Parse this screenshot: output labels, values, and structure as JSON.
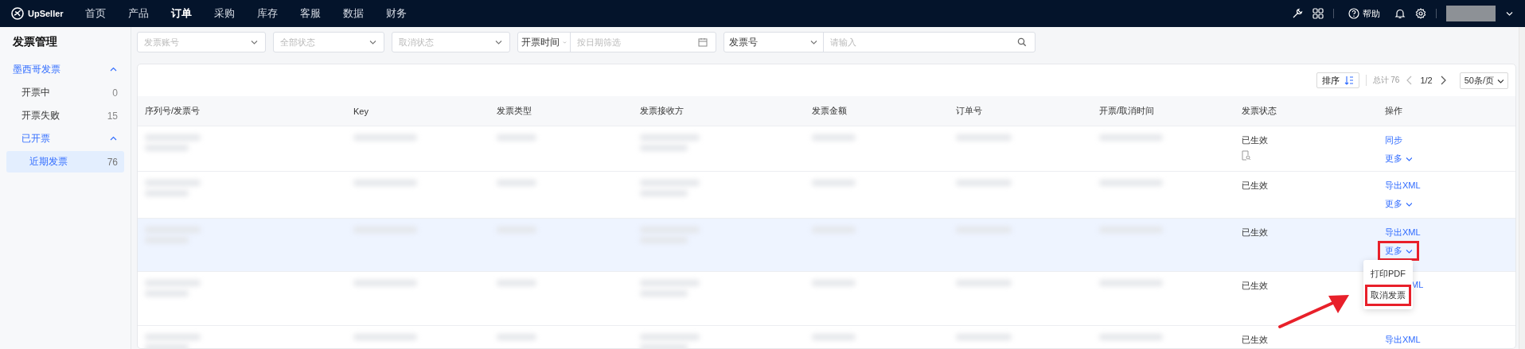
{
  "topbar": {
    "logo": "UpSeller",
    "nav": [
      {
        "label": "首页",
        "selected": false
      },
      {
        "label": "产品",
        "selected": false
      },
      {
        "label": "订单",
        "selected": true
      },
      {
        "label": "采购",
        "selected": false
      },
      {
        "label": "库存",
        "selected": false
      },
      {
        "label": "客服",
        "selected": false
      },
      {
        "label": "数据",
        "selected": false
      },
      {
        "label": "财务",
        "selected": false
      }
    ],
    "help": "帮助"
  },
  "sidebar": {
    "title": "发票管理",
    "items": [
      {
        "label": "墨西哥发票",
        "expanded": true,
        "children": [
          {
            "label": "开票中",
            "count": "0",
            "selected": false
          },
          {
            "label": "开票失败",
            "count": "15",
            "selected": false
          },
          {
            "label": "已开票",
            "expanded": true,
            "children": [
              {
                "label": "近期发票",
                "count": "76",
                "selected": true
              }
            ]
          }
        ]
      }
    ]
  },
  "filters": [
    {
      "kind": "select",
      "placeholder": "发票账号"
    },
    {
      "kind": "select",
      "placeholder": "全部状态"
    },
    {
      "kind": "select",
      "placeholder": "取消状态"
    },
    {
      "kind": "date",
      "label": "开票时间",
      "placeholder": "按日期筛选"
    },
    {
      "kind": "search",
      "label": "发票号",
      "placeholder": "请输入"
    }
  ],
  "toolbar": {
    "sort": "排序",
    "total": "总计 76",
    "page": "1/2",
    "page_size": "50条/页"
  },
  "table": {
    "columns": [
      "序列号/发票号",
      "Key",
      "发票类型",
      "发票接收方",
      "发票金额",
      "订单号",
      "开票/取消时间",
      "发票状态",
      "操作"
    ],
    "rows": [
      {
        "status": "已生效",
        "note_icon": true,
        "hovered": false,
        "action": "同步",
        "more": "更多",
        "more_annotated": false
      },
      {
        "status": "已生效",
        "note_icon": false,
        "hovered": false,
        "action": "导出XML",
        "more": "更多",
        "more_annotated": false
      },
      {
        "status": "已生效",
        "note_icon": false,
        "hovered": true,
        "action": "导出XML",
        "more": "更多",
        "more_annotated": true,
        "menu": [
          {
            "label": "打印PDF",
            "annotated": false
          },
          {
            "label": "取消发票",
            "annotated": true
          }
        ]
      },
      {
        "status": "已生效",
        "note_icon": false,
        "hovered": false,
        "action": "ML",
        "action_covered": true
      },
      {
        "status": "已生效",
        "note_icon": false,
        "hovered": false,
        "action": "导出XML"
      }
    ]
  }
}
